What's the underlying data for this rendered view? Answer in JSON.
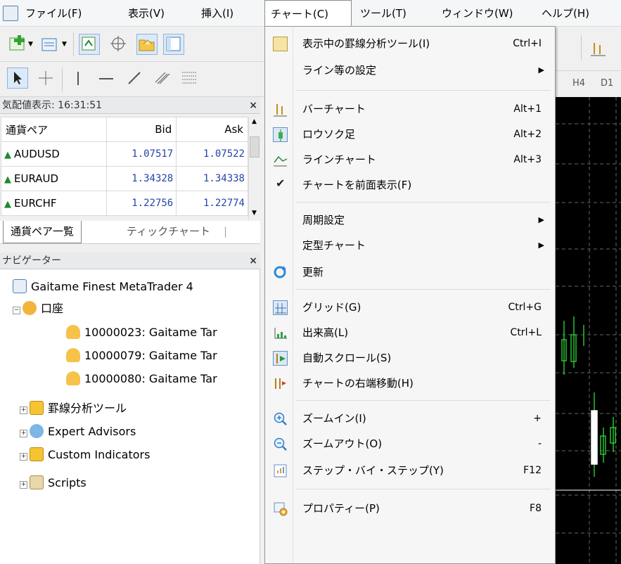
{
  "menubar": {
    "items": [
      "ファイル(F)",
      "表示(V)",
      "挿入(I)",
      "チャート(C)",
      "ツール(T)",
      "ウィンドウ(W)",
      "ヘルプ(H)"
    ],
    "active_index": 3
  },
  "timeframes": [
    "H4",
    "D1"
  ],
  "market_watch": {
    "title": "気配値表示: 16:31:51",
    "columns": [
      "通貨ペア",
      "Bid",
      "Ask"
    ],
    "rows": [
      {
        "symbol": "AUDUSD",
        "bid": "1.07517",
        "ask": "1.07522"
      },
      {
        "symbol": "EURAUD",
        "bid": "1.34328",
        "ask": "1.34338"
      },
      {
        "symbol": "EURCHF",
        "bid": "1.22756",
        "ask": "1.22774"
      }
    ],
    "tabs": [
      "通貨ペア一覧",
      "ティックチャート"
    ]
  },
  "navigator": {
    "title": "ナビゲーター",
    "items": [
      {
        "label": "Gaitame Finest MetaTrader 4",
        "icon": "app-icon"
      },
      {
        "label": "口座",
        "icon": "accounts-icon"
      },
      {
        "label": "10000023: Gaitame Tar",
        "icon": "account-icon"
      },
      {
        "label": "10000079: Gaitame Tar",
        "icon": "account-icon"
      },
      {
        "label": "10000080: Gaitame Tar",
        "icon": "account-icon"
      },
      {
        "label": "罫線分析ツール",
        "icon": "indicators-icon"
      },
      {
        "label": "Expert Advisors",
        "icon": "expert-icon"
      },
      {
        "label": "Custom Indicators",
        "icon": "custom-indicators-icon"
      },
      {
        "label": "Scripts",
        "icon": "scripts-icon"
      }
    ]
  },
  "chart_menu": {
    "items": [
      {
        "label": "表示中の罫線分析ツール(I)",
        "shortcut": "Ctrl+I",
        "icon": "objects-list-icon"
      },
      {
        "label": "ライン等の設定",
        "shortcut": "",
        "submenu": true,
        "icon": ""
      },
      {
        "label": "バーチャート",
        "shortcut": "Alt+1",
        "icon": "bar-chart-icon"
      },
      {
        "label": "ロウソク足",
        "shortcut": "Alt+2",
        "icon": "candlestick-icon"
      },
      {
        "label": "ラインチャート",
        "shortcut": "Alt+3",
        "icon": "line-chart-icon"
      },
      {
        "label": "チャートを前面表示(F)",
        "shortcut": "",
        "icon": "check-icon"
      },
      {
        "label": "周期設定",
        "shortcut": "",
        "submenu": true,
        "icon": ""
      },
      {
        "label": "定型チャート",
        "shortcut": "",
        "submenu": true,
        "icon": ""
      },
      {
        "label": "更新",
        "shortcut": "",
        "icon": "refresh-icon"
      },
      {
        "label": "グリッド(G)",
        "shortcut": "Ctrl+G",
        "icon": "grid-icon"
      },
      {
        "label": "出来高(L)",
        "shortcut": "Ctrl+L",
        "icon": "volumes-icon"
      },
      {
        "label": "自動スクロール(S)",
        "shortcut": "",
        "icon": "autoscroll-icon"
      },
      {
        "label": "チャートの右端移動(H)",
        "shortcut": "",
        "icon": "chart-shift-icon"
      },
      {
        "label": "ズームイン(I)",
        "shortcut": "+",
        "icon": "zoom-in-icon"
      },
      {
        "label": "ズームアウト(O)",
        "shortcut": "-",
        "icon": "zoom-out-icon"
      },
      {
        "label": "ステップ・バイ・ステップ(Y)",
        "shortcut": "F12",
        "icon": "step-icon"
      },
      {
        "label": "プロパティー(P)",
        "shortcut": "F8",
        "icon": "properties-icon"
      }
    ]
  }
}
